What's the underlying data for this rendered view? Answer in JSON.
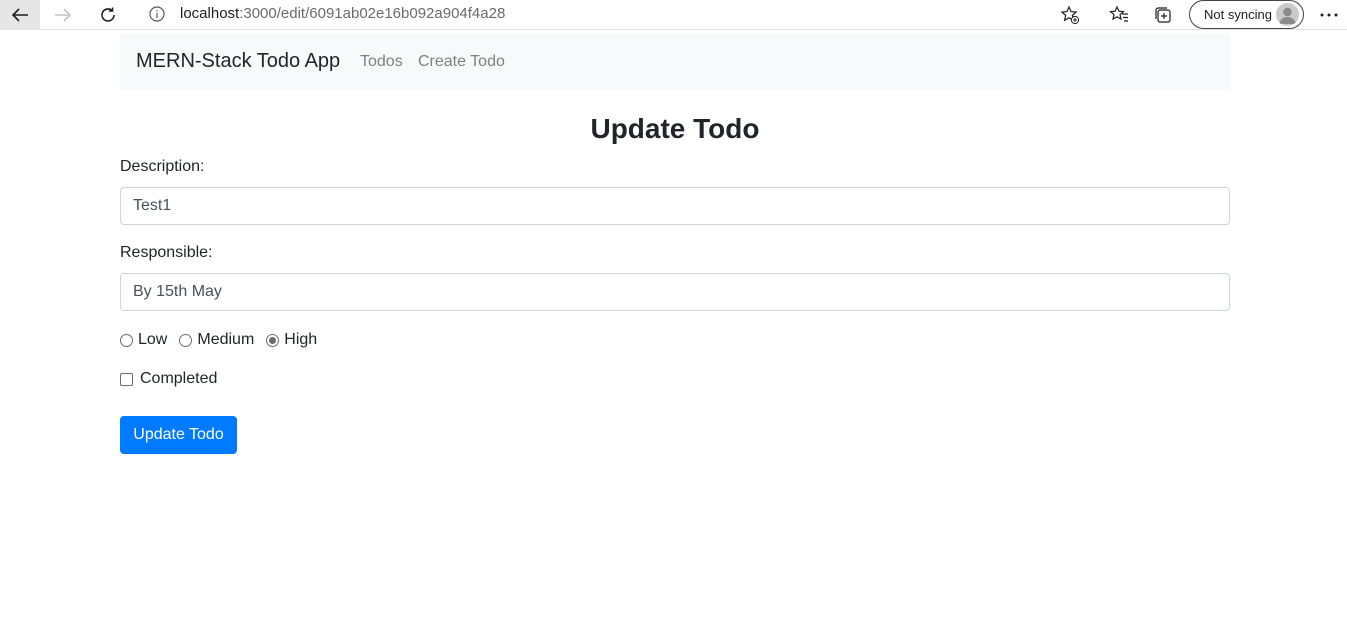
{
  "browser": {
    "url_host": "localhost",
    "url_path": ":3000/edit/6091ab02e16b092a904f4a28",
    "profile_label": "Not syncing",
    "icons": {
      "back": "back-arrow-icon",
      "forward": "forward-arrow-icon",
      "reload": "reload-icon",
      "info": "info-icon",
      "favorite_add": "add-favorite-icon",
      "favorites": "favorites-icon",
      "collections": "collections-icon",
      "avatar": "avatar-icon",
      "more": "more-icon"
    }
  },
  "navbar": {
    "brand": "MERN-Stack Todo App",
    "links": [
      {
        "label": "Todos"
      },
      {
        "label": "Create Todo"
      }
    ],
    "background": "#f8f9fa"
  },
  "form": {
    "title": "Update Todo",
    "description": {
      "label": "Description:",
      "value": "Test1"
    },
    "responsible": {
      "label": "Responsible:",
      "value": "By 15th May"
    },
    "priority": {
      "options": [
        {
          "label": "Low",
          "checked": false
        },
        {
          "label": "Medium",
          "checked": false
        },
        {
          "label": "High",
          "checked": true
        }
      ]
    },
    "completed": {
      "label": "Completed",
      "checked": false
    },
    "submit_label": "Update Todo",
    "submit_color": "#007bff"
  }
}
